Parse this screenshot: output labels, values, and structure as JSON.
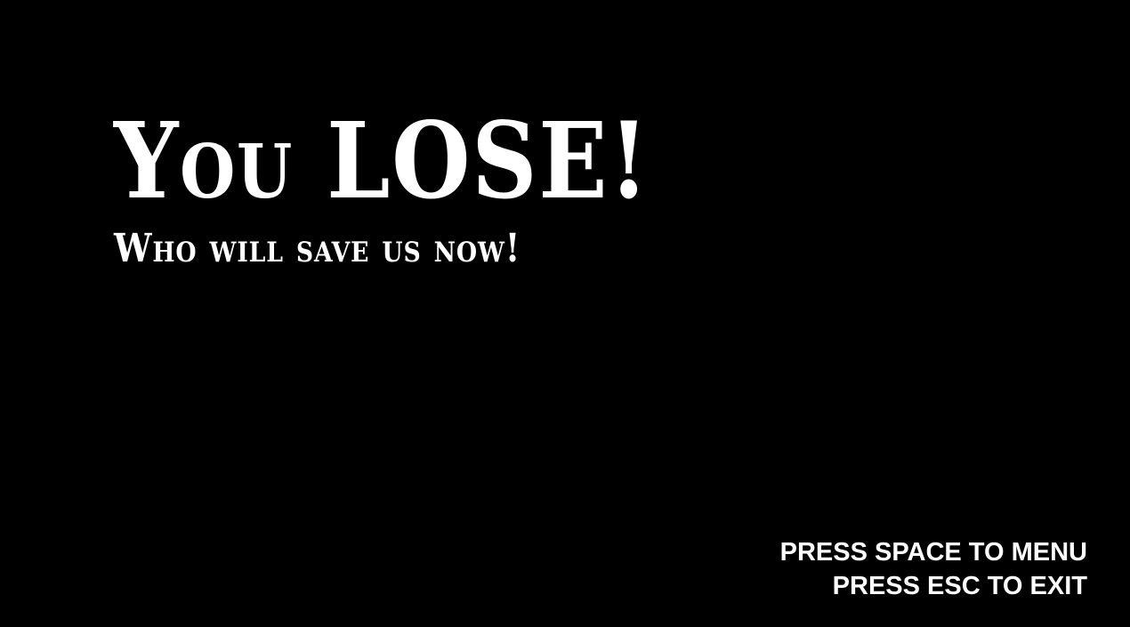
{
  "screen": {
    "background_color": "#000000",
    "text_color": "#ffffff",
    "title": "You LOSE!",
    "subtitle": "Who will save us now!"
  },
  "controls": {
    "menu_hint": "PRESS SPACE TO MENU",
    "exit_hint": "PRESS ESC TO EXIT"
  }
}
